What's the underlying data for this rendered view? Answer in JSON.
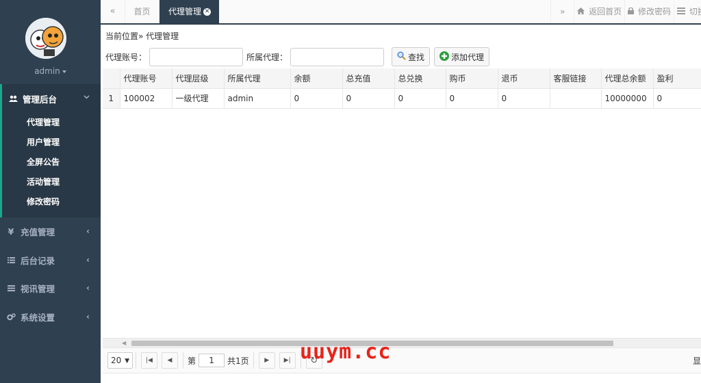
{
  "sidebar": {
    "user": "admin",
    "active_group": {
      "label": "管理后台",
      "icon": "users-icon",
      "items": [
        {
          "label": "代理管理"
        },
        {
          "label": "用户管理"
        },
        {
          "label": "全屏公告"
        },
        {
          "label": "活动管理"
        },
        {
          "label": "修改密码"
        }
      ]
    },
    "groups": [
      {
        "label": "充值管理",
        "icon": "yen-icon"
      },
      {
        "label": "后台记录",
        "icon": "list-icon"
      },
      {
        "label": "视讯管理",
        "icon": "list-alt-icon"
      },
      {
        "label": "系统设置",
        "icon": "gears-icon"
      }
    ]
  },
  "topbar": {
    "prev_symbol": "«",
    "next_symbol": "»",
    "tabs": [
      {
        "label": "首页"
      },
      {
        "label": "代理管理",
        "active": true
      }
    ],
    "actions": [
      {
        "label": "返回首页",
        "icon": "home-icon"
      },
      {
        "label": "修改密码",
        "icon": "lock-icon"
      },
      {
        "label": "切换",
        "icon": "menu-icon"
      }
    ]
  },
  "content": {
    "breadcrumb": "当前位置» 代理管理",
    "search": {
      "agent_account_label": "代理账号：",
      "agent_account_value": "",
      "parent_agent_label": "所属代理：",
      "parent_agent_value": "",
      "search_button": "查找",
      "add_button": "添加代理"
    },
    "table": {
      "columns": [
        "代理账号",
        "代理层级",
        "所属代理",
        "余额",
        "总充值",
        "总兑换",
        "购币",
        "退币",
        "客服链接",
        "代理总余额",
        "盈利"
      ],
      "rows": [
        {
          "index": "1",
          "cells": [
            "100002",
            "一级代理",
            "admin",
            "0",
            "0",
            "0",
            "0",
            "0",
            "",
            "10000000",
            "0"
          ]
        }
      ]
    },
    "pager": {
      "page_size": "20",
      "page_prefix": "第",
      "current_page": "1",
      "total_pages": "共1页",
      "right_text": "显"
    }
  },
  "watermark": "uuym.cc",
  "colors": {
    "sidebar_bg": "#2f4050",
    "accent": "#19aa8d",
    "watermark": "#e8231a"
  }
}
